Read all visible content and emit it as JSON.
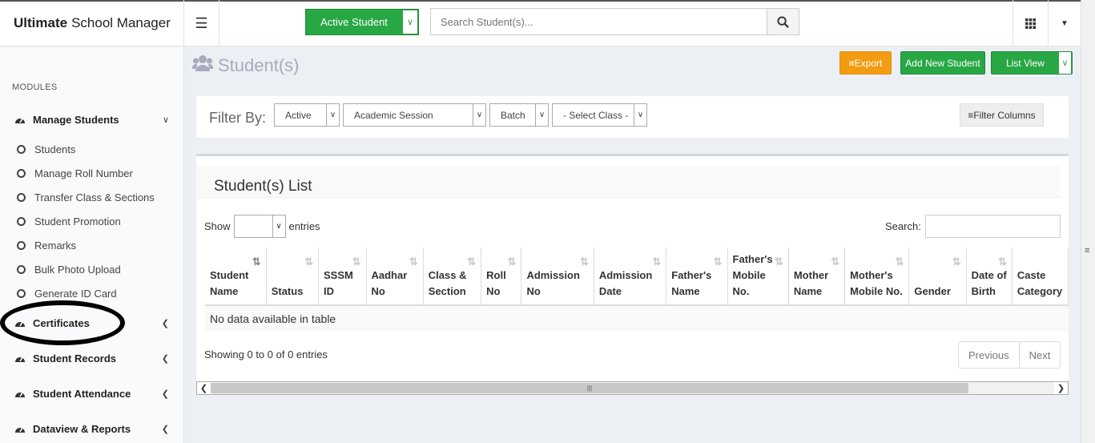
{
  "brand": {
    "bold": "Ultimate",
    "rest": "School Manager"
  },
  "topbar": {
    "active_button": "Active Student",
    "search_placeholder": "Search Student(s)..."
  },
  "sidebar": {
    "header": "MODULES",
    "manage_students": "Manage Students",
    "sub_items": [
      "Students",
      "Manage Roll Number",
      "Transfer Class & Sections",
      "Student Promotion",
      "Remarks",
      "Bulk Photo Upload",
      "Generate ID Card"
    ],
    "certificates": "Certificates",
    "student_records": "Student Records",
    "student_attendance": "Student Attendance",
    "dataview_reports": "Dataview & Reports"
  },
  "page": {
    "title": "Student(s)",
    "export": "Export",
    "add_new": "Add New Student",
    "list_view": "List View"
  },
  "filter": {
    "label": "Filter By:",
    "status": "Active",
    "session": "Academic Session",
    "batch": "Batch",
    "class": "- Select Class -",
    "filter_columns": "Filter Columns"
  },
  "list": {
    "title": "Student(s) List",
    "show": "Show",
    "entries": "entries",
    "search_label": "Search:",
    "columns": [
      "Student Name",
      "Status",
      "SSSM ID",
      "Aadhar No",
      "Class & Section",
      "Roll No",
      "Admission No",
      "Admission Date",
      "Father's Name",
      "Father's Mobile No.",
      "Mother Name",
      "Mother's Mobile No.",
      "Gender",
      "Date of Birth",
      "Caste Category"
    ],
    "empty": "No data available in table",
    "info": "Showing 0 to 0 of 0 entries",
    "previous": "Previous",
    "next": "Next"
  },
  "colors": {
    "green": "#28a745",
    "orange": "#f39c12"
  }
}
